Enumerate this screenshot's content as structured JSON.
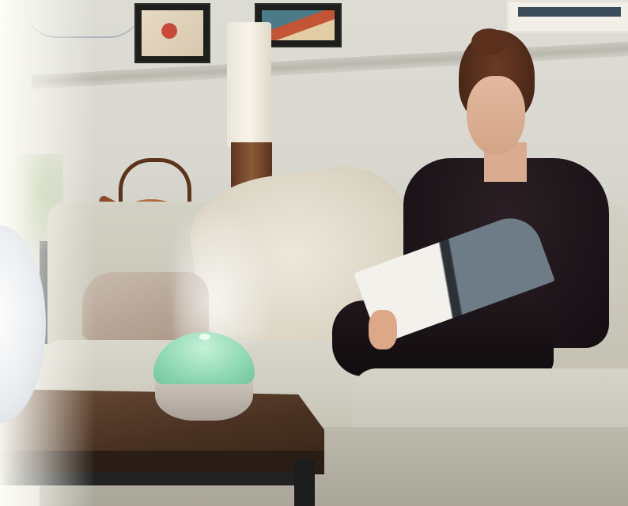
{
  "scene": {
    "colors": {
      "wall": "#dcdcd5",
      "sofa": "#d3d0c4",
      "diffuser_light": "#8fd8b4",
      "diffuser_base": "#cfc6bd",
      "table_wood": "#4a3222",
      "clothing": "#140e12"
    }
  }
}
